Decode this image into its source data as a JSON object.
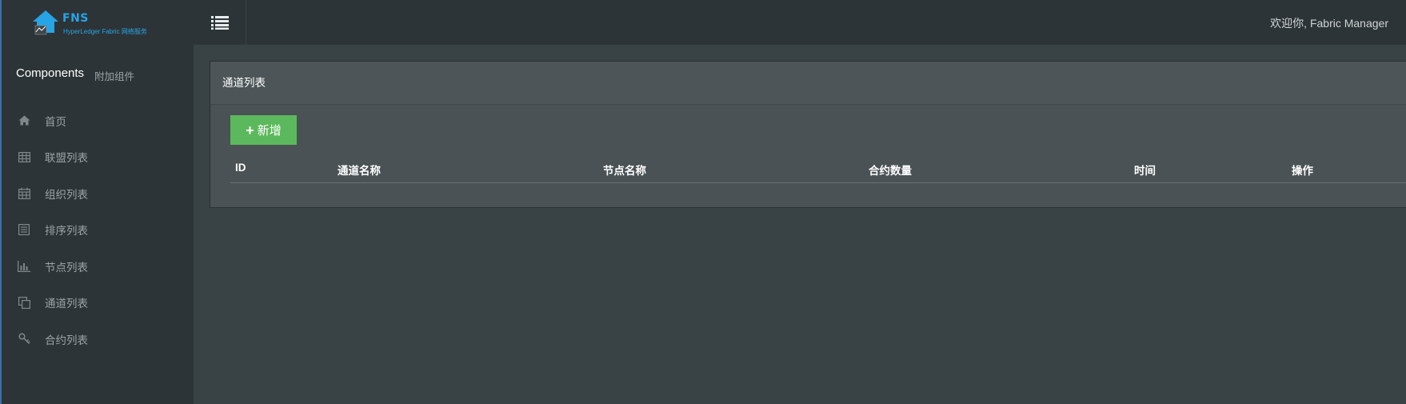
{
  "logo": {
    "brand": "FNS",
    "tagline": "HyperLedger Fabric 网络服务"
  },
  "sidebar": {
    "title": "Components",
    "subtitle": "附加组件",
    "items": [
      {
        "label": "首页",
        "icon": "home-icon"
      },
      {
        "label": "联盟列表",
        "icon": "table-icon"
      },
      {
        "label": "组织列表",
        "icon": "calendar-icon"
      },
      {
        "label": "排序列表",
        "icon": "list-alt-icon"
      },
      {
        "label": "节点列表",
        "icon": "bar-chart-icon"
      },
      {
        "label": "通道列表",
        "icon": "copy-icon"
      },
      {
        "label": "合约列表",
        "icon": "key-icon"
      }
    ]
  },
  "header": {
    "menu_toggle_icon": "list-icon",
    "welcome": "欢迎你, Fabric Manager"
  },
  "panel": {
    "title": "通道列表",
    "add_button": "新增",
    "columns": [
      "ID",
      "通道名称",
      "节点名称",
      "合约数量",
      "时间",
      "操作"
    ]
  },
  "colors": {
    "sidebar_bg": "#2d3437",
    "content_bg": "#394245",
    "panel_bg": "#4a5255",
    "brand_blue": "#27a4e6",
    "success_green": "#5cb85c"
  }
}
